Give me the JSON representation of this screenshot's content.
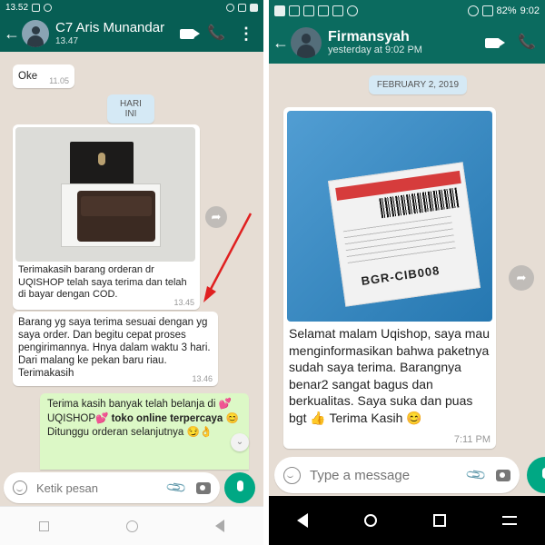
{
  "left": {
    "status_time": "13.52",
    "contact_name": "C7 Aris Munandar",
    "contact_status": "13.47",
    "msg_oke": {
      "text": "Oke",
      "time": "11.05"
    },
    "date_chip": "HARI INI",
    "photo_msg": {
      "caption": "Terimakasih barang orderan dr UQISHOP telah saya terima dan telah di bayar dengan COD.",
      "time": "13.45"
    },
    "msg_review": {
      "text": "Barang yg saya terima sesuai dengan yg saya order. Dan begitu cepat proses pengirimannya. Hnya dalam waktu 3 hari. Dari malang ke pekan baru riau. Terimakasih",
      "time": "13.46"
    },
    "out_msg": {
      "line1": "Terima kasih banyak telah belanja di",
      "emoji_heart": "💕",
      "brand": "UQISHOP",
      "bold_tail": "toko online terpercaya",
      "emoji_smile": "😊",
      "line3": "Ditunggu orderan selanjutnya",
      "emoji_end": "😏👌"
    },
    "input_placeholder": "Ketik pesan"
  },
  "right": {
    "status_battery": "82%",
    "status_time": "9:02",
    "contact_name": "Firmansyah",
    "contact_status": "yesterday at 9:02 PM",
    "date_chip": "FEBRUARY 2, 2019",
    "parcel_label": "BGR-CIB008",
    "caption": "Selamat malam Uqishop, saya mau menginformasikan bahwa paketnya sudah saya terima. Barangnya benar2 sangat bagus dan berkualitas. Saya suka dan puas bgt",
    "caption_tail": "Terima Kasih",
    "emoji_thumb": "👍",
    "emoji_smile": "😊",
    "time": "7:11 PM",
    "input_placeholder": "Type a message"
  },
  "icons": {
    "back": "←",
    "call": "📞",
    "menu": "⋮",
    "clip": "📎",
    "forward": "➦",
    "scroll_down": "⌄"
  },
  "colors": {
    "header": "#075e54",
    "chat_bg": "#e6ddd4",
    "outgoing": "#dcf8c6",
    "accent": "#00a884",
    "annotation_arrow": "#e02020"
  }
}
